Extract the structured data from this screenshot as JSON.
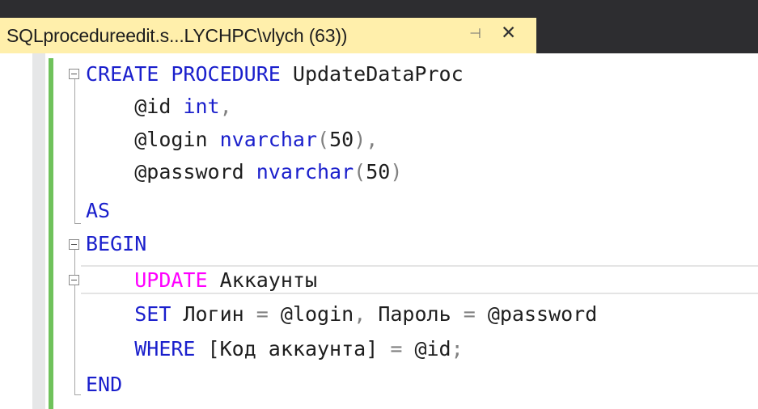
{
  "tab": {
    "title": "SQLprocedureedit.s...LYCHPC\\vlych (63))",
    "pin_glyph": "⊣",
    "close_glyph": "✕"
  },
  "code": {
    "line1": {
      "kw_create": "CREATE",
      "kw_procedure": "PROCEDURE",
      "proc_name": "UpdateDataProc"
    },
    "line2": {
      "param": "@id",
      "type": "int",
      "comma": ","
    },
    "line3": {
      "param": "@login",
      "type": "nvarchar",
      "open": "(",
      "size": "50",
      "close": ")",
      "comma": ","
    },
    "line4": {
      "param": "@password",
      "type": "nvarchar",
      "open": "(",
      "size": "50",
      "close": ")"
    },
    "line5": {
      "kw_as": "AS"
    },
    "line6": {
      "kw_begin": "BEGIN"
    },
    "line7": {
      "kw_update": "UPDATE",
      "table": "Аккаунты"
    },
    "line8": {
      "kw_set": "SET",
      "col1": "Логин",
      "eq1": "=",
      "val1": "@login",
      "comma": ",",
      "col2": "Пароль",
      "eq2": "=",
      "val2": "@password"
    },
    "line9": {
      "kw_where": "WHERE",
      "col": "[Код аккаунта]",
      "eq": "=",
      "val": "@id",
      "semicolon": ";"
    },
    "line10": {
      "kw_end": "END"
    }
  },
  "colors": {
    "tab_active_bg": "#ffefab",
    "tab_strip_bg": "#2d2d30",
    "keyword_blue": "#1a1fcc",
    "keyword_magenta": "#ff00ff",
    "operator_gray": "#808080",
    "change_bar_green": "#6fc25b"
  }
}
